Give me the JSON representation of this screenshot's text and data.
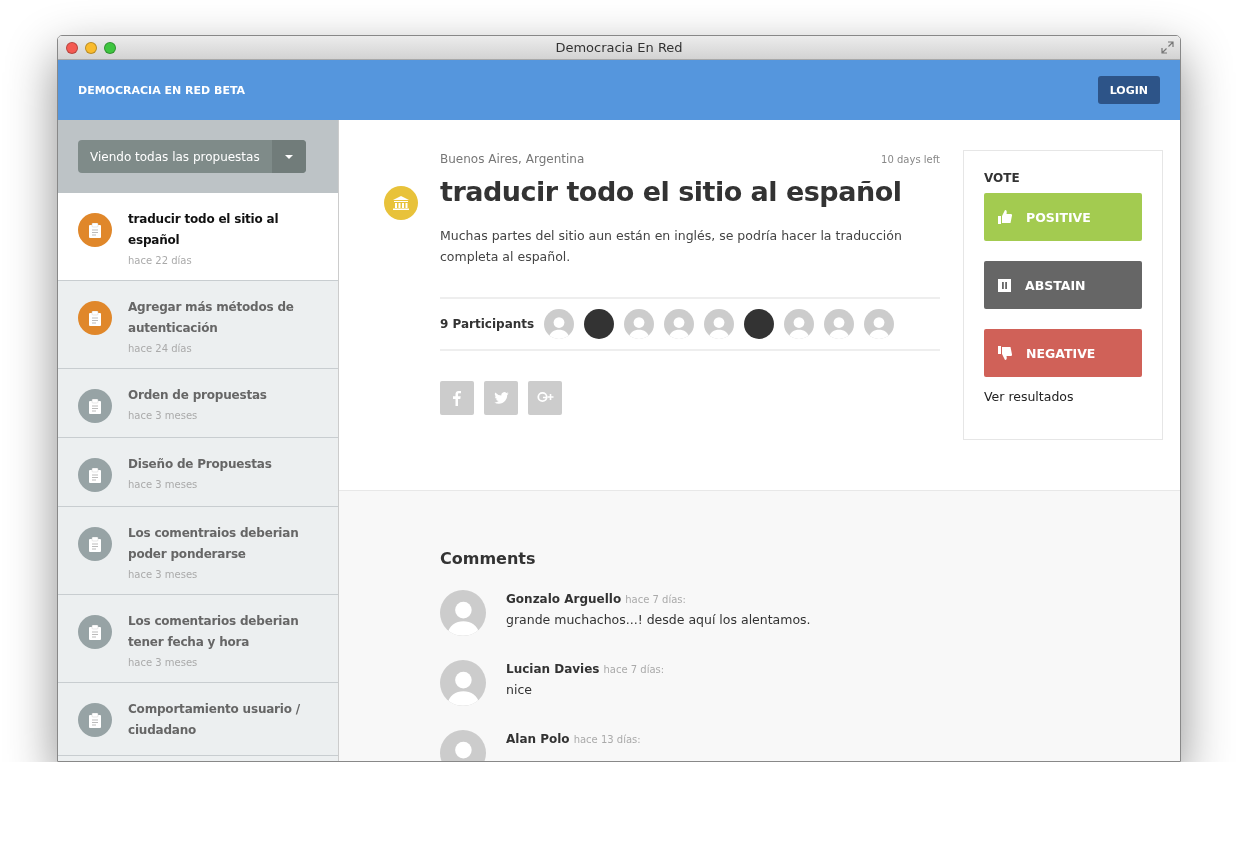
{
  "window": {
    "title": "Democracia En Red"
  },
  "header": {
    "brand": "DEMOCRACIA EN RED BETA",
    "login": "LOGIN"
  },
  "sidebar": {
    "filter": "Viendo todas las propuestas",
    "items": [
      {
        "title": "traducir todo el sitio al español",
        "date": "hace 22 días",
        "selected": true,
        "color": "#e0872a"
      },
      {
        "title": "Agregar más métodos de autenticación",
        "date": "hace 24 días",
        "selected": false,
        "color": "#e0872a"
      },
      {
        "title": "Orden de propuestas",
        "date": "hace 3 meses",
        "selected": false,
        "color": "#97a3a5"
      },
      {
        "title": "Diseño de Propuestas",
        "date": "hace 3 meses",
        "selected": false,
        "color": "#97a3a5"
      },
      {
        "title": "Los comentraios deberian poder ponderarse",
        "date": "hace 3 meses",
        "selected": false,
        "color": "#97a3a5"
      },
      {
        "title": "Los comentarios deberian tener fecha y hora",
        "date": "hace 3 meses",
        "selected": false,
        "color": "#97a3a5"
      },
      {
        "title": "Comportamiento usuario / ciudadano",
        "selected": false,
        "color": "#97a3a5"
      }
    ]
  },
  "proposal": {
    "location": "Buenos Aires, Argentina",
    "time_left": "10 days left",
    "title": "traducir todo el sitio al español",
    "body": "Muchas partes del sitio aun están en inglés, se podría hacer la traducción completa al español.",
    "participants_label": "9 Participants",
    "participants": [
      {
        "kind": "default"
      },
      {
        "kind": "photo"
      },
      {
        "kind": "default"
      },
      {
        "kind": "default"
      },
      {
        "kind": "default"
      },
      {
        "kind": "photo"
      },
      {
        "kind": "default"
      },
      {
        "kind": "default"
      },
      {
        "kind": "default"
      }
    ],
    "share": [
      {
        "kind": "facebook"
      },
      {
        "kind": "twitter"
      },
      {
        "kind": "googleplus"
      }
    ]
  },
  "vote": {
    "title": "VOTE",
    "options": [
      {
        "kind": "positive",
        "label": "POSITIVE"
      },
      {
        "kind": "abstain",
        "label": "ABSTAIN"
      },
      {
        "kind": "negative",
        "label": "NEGATIVE"
      }
    ],
    "results_link": "Ver resultados"
  },
  "comments": {
    "title": "Comments",
    "items": [
      {
        "author": "Gonzalo Arguello",
        "time": "hace 7 días:",
        "text": "grande muchachos...! desde aquí los alentamos."
      },
      {
        "author": "Lucian Davies",
        "time": "hace 7 días:",
        "text": "nice"
      },
      {
        "author": "Alan Polo",
        "time": "hace 13 días:"
      }
    ]
  }
}
